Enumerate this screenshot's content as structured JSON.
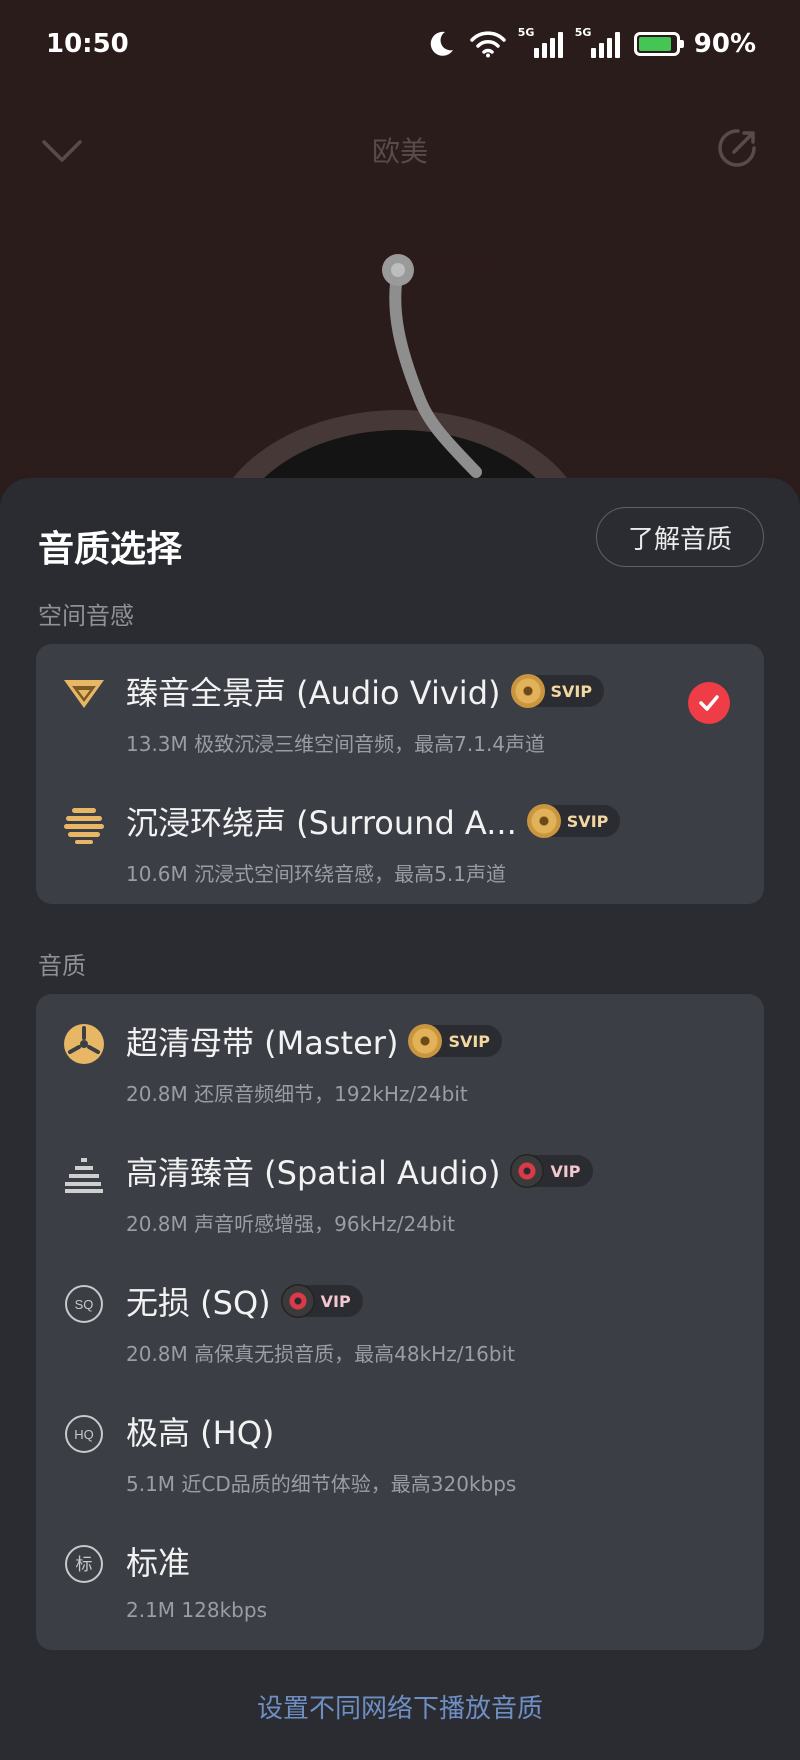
{
  "status_bar": {
    "time": "10:50",
    "signal1_label": "5G",
    "signal2_label": "5G",
    "battery_percent": "90%",
    "battery_level": 0.9
  },
  "player": {
    "title": "欧美"
  },
  "sheet": {
    "title": "音质选择",
    "learn_button": "了解音质",
    "spatial_section": "空间音感",
    "quality_section": "音质",
    "spatial_options": [
      {
        "name": "臻音全景声 (Audio Vivid)",
        "badge": "SVIP",
        "desc": "13.3M  极致沉浸三维空间音频，最高7.1.4声道",
        "icon": "audio-vivid-icon",
        "selected": true
      },
      {
        "name": "沉浸环绕声 (Surround A...",
        "badge": "SVIP",
        "desc": "10.6M  沉浸式空间环绕音感，最高5.1声道",
        "icon": "surround-icon",
        "selected": false
      }
    ],
    "quality_options": [
      {
        "name": "超清母带 (Master)",
        "badge": "SVIP",
        "desc": "20.8M  还原音频细节，192kHz/24bit",
        "icon": "master-icon"
      },
      {
        "name": "高清臻音 (Spatial Audio)",
        "badge": "VIP",
        "desc": "20.8M  声音听感增强，96kHz/24bit",
        "icon": "spatial-audio-icon"
      },
      {
        "name": "无损 (SQ)",
        "badge": "VIP",
        "desc": "20.8M  高保真无损音质，最高48kHz/16bit",
        "icon": "sq-icon",
        "icon_text": "SQ"
      },
      {
        "name": "极高 (HQ)",
        "badge": "",
        "desc": "5.1M  近CD品质的细节体验，最高320kbps",
        "icon": "hq-icon",
        "icon_text": "HQ"
      },
      {
        "name": "标准",
        "badge": "",
        "desc": "2.1M  128kbps",
        "icon": "standard-icon",
        "icon_text": "标"
      }
    ],
    "footer_link": "设置不同网络下播放音质"
  },
  "colors": {
    "accent_gold": "#e2b25a",
    "check_red": "#ee3d46",
    "link_blue": "#6f8fc4",
    "sheet_bg": "#2a2c31",
    "card_bg": "#3b3e45"
  }
}
